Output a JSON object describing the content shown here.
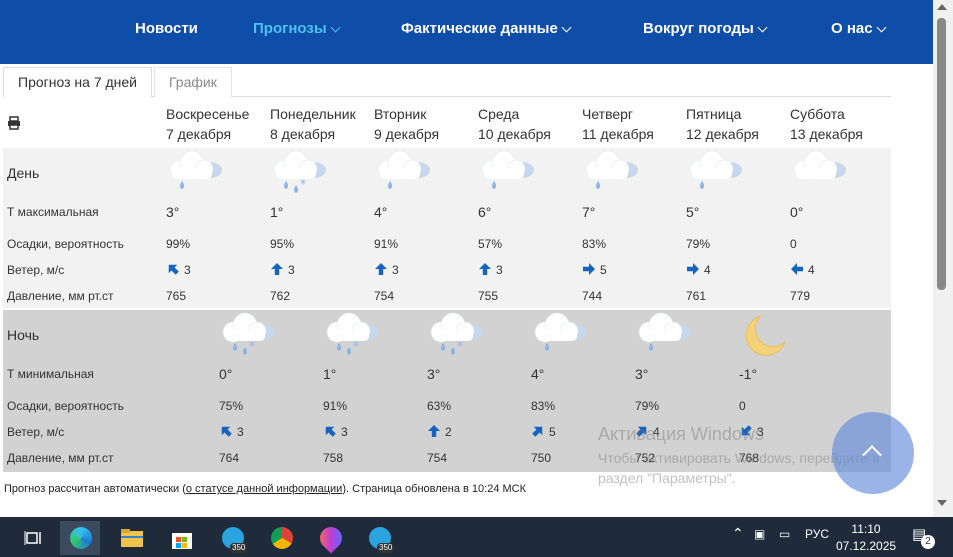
{
  "nav": {
    "items": [
      "Новости",
      "Прогнозы",
      "Фактические данные",
      "Вокруг погоды",
      "О нас"
    ],
    "active_color": "#4ec1f0",
    "bg_color": "#0e4ea8"
  },
  "tabs": [
    "Прогноз на 7 дней",
    "График"
  ],
  "print_icon": "printer-icon",
  "days": [
    {
      "name": "Воскресенье",
      "date": "7 декабря"
    },
    {
      "name": "Понедельник",
      "date": "8 декабря"
    },
    {
      "name": "Вторник",
      "date": "9 декабря"
    },
    {
      "name": "Среда",
      "date": "10 декабря"
    },
    {
      "name": "Четверг",
      "date": "11 декабря"
    },
    {
      "name": "Пятница",
      "date": "12 декабря"
    },
    {
      "name": "Суббота",
      "date": "13 декабря"
    }
  ],
  "day_section": {
    "title": "День",
    "labels": {
      "temp": "Т максимальная",
      "precip": "Осадки, вероятность",
      "wind": "Ветер, м/с",
      "pressure": "Давление, мм рт.ст"
    },
    "icons": [
      "cloud-rain-icon",
      "cloud-snow-rain-icon",
      "cloud-rain-icon",
      "cloud-rain-icon",
      "cloud-rain-icon",
      "cloud-rain-icon",
      "cloud-icon"
    ],
    "temp": [
      "3°",
      "1°",
      "4°",
      "6°",
      "7°",
      "5°",
      "0°"
    ],
    "precip": [
      "99%",
      "95%",
      "91%",
      "57%",
      "83%",
      "79%",
      "0"
    ],
    "wind_dir": [
      "nw",
      "n",
      "n",
      "n",
      "e",
      "e",
      "w"
    ],
    "wind": [
      "3",
      "3",
      "3",
      "3",
      "5",
      "4",
      "4"
    ],
    "pressure": [
      "765",
      "762",
      "754",
      "755",
      "744",
      "761",
      "779"
    ]
  },
  "night_section": {
    "title": "Ночь",
    "labels": {
      "temp": "Т минимальная",
      "precip": "Осадки, вероятность",
      "wind": "Ветер, м/с",
      "pressure": "Давление, мм рт.ст"
    },
    "icons": [
      "cloud-snow-rain-icon",
      "cloud-snow-rain-icon",
      "cloud-snow-rain-icon",
      "cloud-rain-icon",
      "cloud-rain-icon",
      "moon-icon"
    ],
    "temp": [
      "0°",
      "1°",
      "3°",
      "4°",
      "3°",
      "-1°"
    ],
    "precip": [
      "75%",
      "91%",
      "63%",
      "83%",
      "79%",
      "0"
    ],
    "wind_dir": [
      "nw",
      "nw",
      "n",
      "ne",
      "ne",
      "sw"
    ],
    "wind": [
      "3",
      "3",
      "2",
      "5",
      "4",
      "3"
    ],
    "pressure": [
      "764",
      "758",
      "754",
      "750",
      "752",
      "768"
    ]
  },
  "footer": {
    "prefix": "Прогноз рассчитан автоматически (",
    "link": "о статусе данной информации",
    "suffix": "). Страница обновлена в 10:24 МСК"
  },
  "watermark": {
    "line1": "Активация Windows",
    "line2": "Чтобы активировать Windows, перейдите в раздел \"Параметры\"."
  },
  "taskbar": {
    "badges": [
      "350",
      "350"
    ],
    "lang": "РУС",
    "time": "11:10",
    "date": "07.12.2025",
    "notif_count": "2"
  },
  "colors": {
    "arrow": "#1565c0",
    "cloud": "#ffffff",
    "cloud_shadow": "#c6d8ee",
    "drop": "#8bb5e6",
    "moon": "#f3d27a"
  }
}
